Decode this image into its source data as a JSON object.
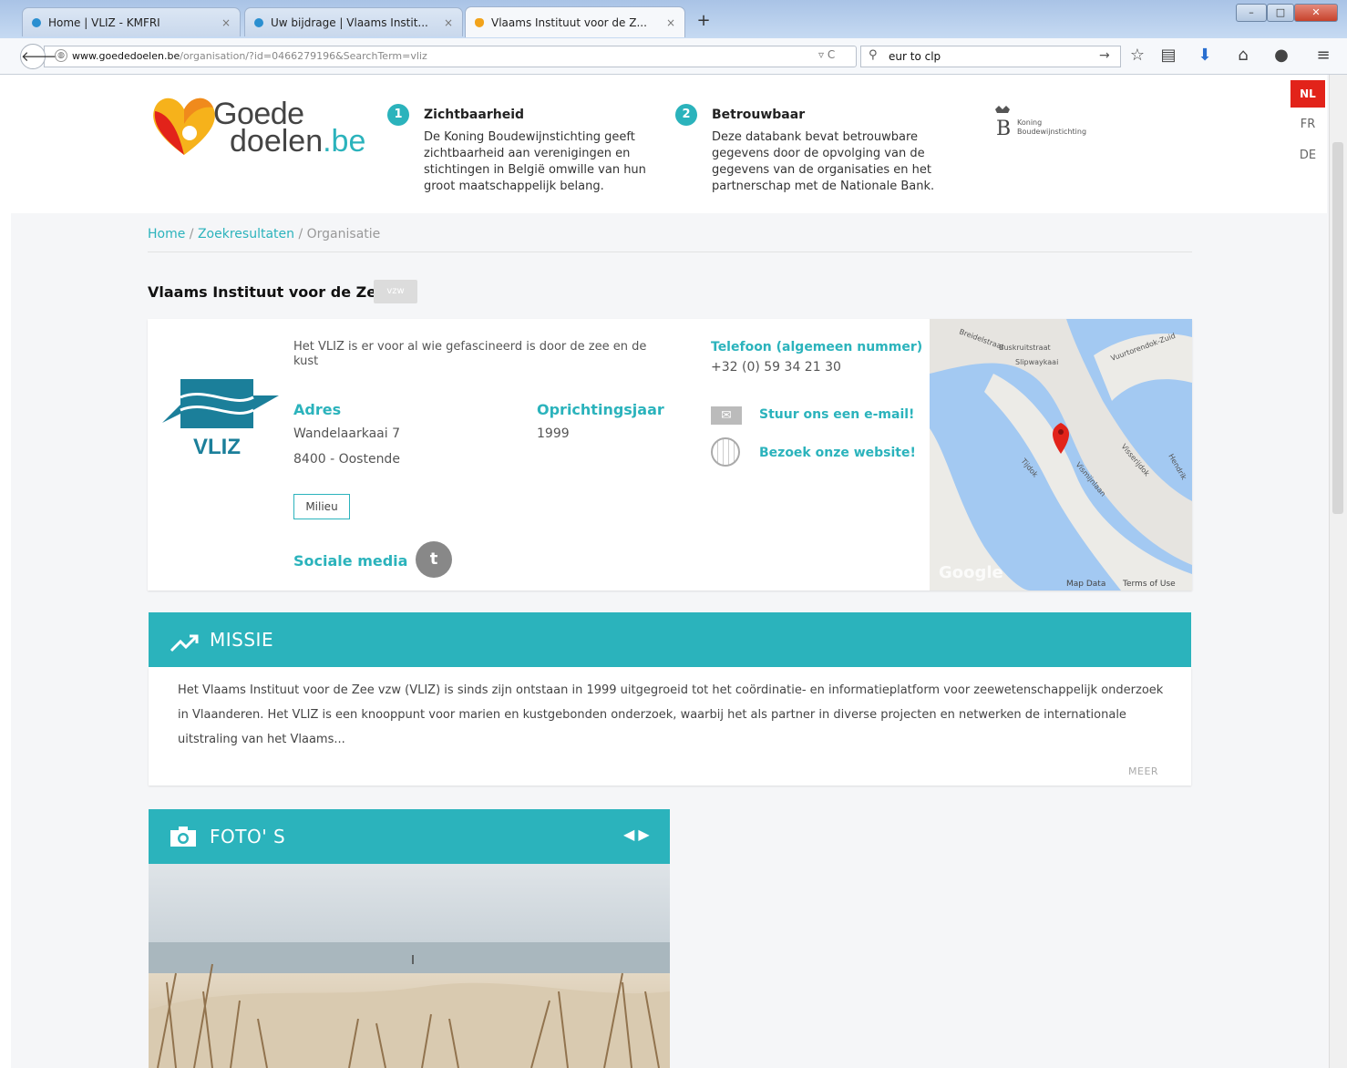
{
  "browser": {
    "tabs": [
      {
        "label": "Home | VLIZ - KMFRI",
        "close": "×"
      },
      {
        "label": "Uw bijdrage | Vlaams Instit...",
        "close": "×"
      },
      {
        "label": "Vlaams Instituut voor de Z...",
        "close": "×"
      }
    ],
    "new_tab": "+",
    "url_host": "www.goededoelen.be",
    "url_path": "/organisation/?id=0466279196&SearchTerm=vliz",
    "search_value": "eur to clp"
  },
  "header": {
    "logo_line1": "Goede",
    "logo_line2_main": "doelen",
    "logo_line2_suffix": ".be",
    "feature1": {
      "num": "1",
      "title": "Zichtbaarheid",
      "text": "De Koning Boudewijnstichting geeft zichtbaarheid aan verenigingen en stichtingen in België omwille van hun groot maatschappelijk belang."
    },
    "feature2": {
      "num": "2",
      "title": "Betrouwbaar",
      "text": "Deze databank bevat betrouwbare gegevens door de opvolging van de gegevens van de organisaties en het partnerschap met de Nationale Bank."
    },
    "kbs_name": "Koning Boudewijnstichting",
    "languages": [
      "NL",
      "FR",
      "DE"
    ]
  },
  "breadcrumb": {
    "home": "Home",
    "results": "Zoekresultaten",
    "current": "Organisatie",
    "sep": " / "
  },
  "org": {
    "name": "Vlaams Instituut voor de Zee",
    "badge": "vzw",
    "logo_text": "VLIZ",
    "tagline": "Het VLIZ is er voor al wie gefascineerd is door de zee en de kust",
    "address_label": "Adres",
    "address_line1": "Wandelaarkaai 7",
    "address_line2": "8400 - Oostende",
    "founded_label": "Oprichtingsjaar",
    "founded_value": "1999",
    "tag": "Milieu",
    "social_label": "Sociale media",
    "phone_label": "Telefoon (algemeen nummer)",
    "phone_value": "+32 (0) 59 34 21 30",
    "email_link": "Stuur ons een e-mail!",
    "website_link": "Bezoek onze website!"
  },
  "map": {
    "labels": [
      "Breidelstraat",
      "Buskruitstraat",
      "Slipwaykaai",
      "Vuurtorendok-Zuid",
      "Tijdok",
      "Vismijnlaan",
      "Visserijdok",
      "Hendrik"
    ],
    "google": "Google",
    "map_data": "Map Data",
    "terms": "Terms of Use"
  },
  "missie": {
    "title": "MISSIE",
    "text": "Het Vlaams Instituut voor de Zee vzw (VLIZ) is sinds zijn ontstaan in 1999 uitgegroeid tot het coördinatie- en informatieplatform voor zeewetenschappelijk onderzoek in Vlaanderen. Het VLIZ is een knooppunt voor marien en kustgebonden onderzoek, waarbij het als partner in diverse projecten en netwerken de internationale uitstraling van het Vlaams...",
    "more": "MEER"
  },
  "fotos": {
    "title": "FOTO' S"
  },
  "colors": {
    "accent": "#2bb3bc",
    "nl_active": "#e2231a"
  }
}
